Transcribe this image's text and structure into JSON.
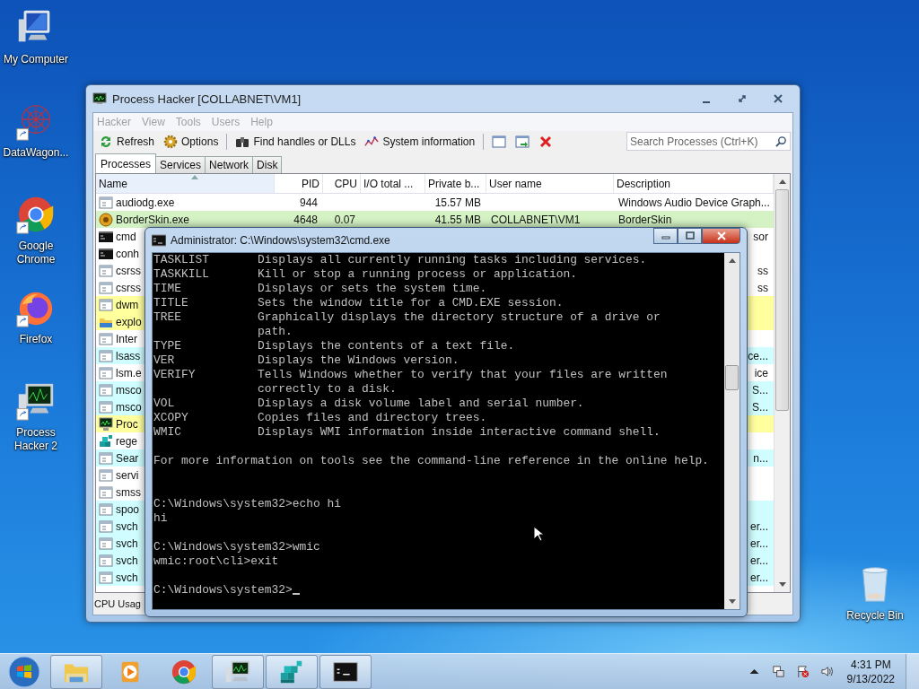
{
  "desktop_icons": [
    {
      "label": "My Computer",
      "kind": "computer",
      "shortcut": false
    },
    {
      "label": "DataWagon...",
      "kind": "datawagon",
      "shortcut": true
    },
    {
      "label": "Google Chrome",
      "kind": "chrome",
      "shortcut": true
    },
    {
      "label": "Firefox",
      "kind": "firefox",
      "shortcut": true
    },
    {
      "label": "Process Hacker 2",
      "kind": "processhacker",
      "shortcut": true
    }
  ],
  "recycle_bin": {
    "label": "Recycle Bin",
    "kind": "recyclebin",
    "shortcut": false
  },
  "process_hacker": {
    "title": "Process Hacker [COLLABNET\\VM1]",
    "menu": [
      "Hacker",
      "View",
      "Tools",
      "Users",
      "Help"
    ],
    "toolbar": [
      {
        "label": "Refresh",
        "kind": "refresh"
      },
      {
        "label": "Options",
        "kind": "gear"
      },
      {
        "label": "Find handles or DLLs",
        "kind": "binoculars"
      },
      {
        "label": "System information",
        "kind": "graph"
      }
    ],
    "toolbar_icons": [
      {
        "kind": "window"
      },
      {
        "kind": "window-arrow"
      },
      {
        "kind": "close"
      }
    ],
    "search": {
      "placeholder": "Search Processes (Ctrl+K)"
    },
    "tabs": [
      {
        "label": "Processes",
        "selected": true
      },
      {
        "label": "Services",
        "selected": false
      },
      {
        "label": "Network",
        "selected": false
      },
      {
        "label": "Disk",
        "selected": false
      }
    ],
    "columns": [
      {
        "label": "Name",
        "sorted": true
      },
      {
        "label": "PID",
        "sorted": false
      },
      {
        "label": "CPU",
        "sorted": false
      },
      {
        "label": "I/O total ...",
        "sorted": false
      },
      {
        "label": "Private b...",
        "sorted": false
      },
      {
        "label": "User name",
        "sorted": false
      },
      {
        "label": "Description",
        "sorted": false
      }
    ],
    "rows": [
      {
        "kind": "window",
        "name": "audiodg.exe",
        "pid": "944",
        "private": "15.57 MB",
        "description": "Windows Audio Device Graph..."
      },
      {
        "kind": "orb",
        "name": "BorderSkin.exe",
        "pid": "4648",
        "cpu": "0.07",
        "private": "41.55 MB",
        "user": "COLLABNET\\VM1",
        "description": "BorderSkin",
        "color": "#d4f2c4"
      },
      {
        "kind": "console",
        "name": "cmd",
        "description": "sor"
      },
      {
        "kind": "console",
        "name": "conh"
      },
      {
        "kind": "window",
        "name": "csrss",
        "description": "ss"
      },
      {
        "kind": "window",
        "name": "csrss",
        "description": "ss"
      },
      {
        "kind": "window",
        "name": "dwm",
        "color": "#ffff9e"
      },
      {
        "kind": "folder",
        "name": "explo",
        "color": "#ffff9e"
      },
      {
        "kind": "window",
        "name": "Inter"
      },
      {
        "kind": "window",
        "name": "lsass",
        "description": "ce...",
        "color": "#d0fdff"
      },
      {
        "kind": "window",
        "name": "lsm.e",
        "description": "ice"
      },
      {
        "kind": "window",
        "name": "msco",
        "description": "S...",
        "color": "#d0fdff"
      },
      {
        "kind": "window",
        "name": "msco",
        "description": "S...",
        "color": "#d0fdff"
      },
      {
        "kind": "monitor",
        "name": "Proc",
        "color": "#ffff9e"
      },
      {
        "kind": "cubes",
        "name": "rege"
      },
      {
        "kind": "window",
        "name": "Sear",
        "description": "n...",
        "color": "#d0fdff"
      },
      {
        "kind": "window",
        "name": "servi"
      },
      {
        "kind": "window",
        "name": "smss"
      },
      {
        "kind": "window",
        "name": "spoo",
        "color": "#d0fdff"
      },
      {
        "kind": "window",
        "name": "svch",
        "description": "er...",
        "color": "#d0fdff"
      },
      {
        "kind": "window",
        "name": "svch",
        "description": "er...",
        "color": "#d0fdff"
      },
      {
        "kind": "window",
        "name": "svch",
        "description": "er...",
        "color": "#d0fdff"
      },
      {
        "kind": "window",
        "name": "svch",
        "description": "er...",
        "color": "#d0fdff"
      }
    ],
    "status_bar": "CPU Usag"
  },
  "cmd": {
    "title": "Administrator: C:\\Windows\\system32\\cmd.exe",
    "cursor_visible": true,
    "lines": [
      {
        "text": "TASKLIST       Displays all currently running tasks including services."
      },
      {
        "text": "TASKKILL       Kill or stop a running process or application."
      },
      {
        "text": "TIME           Displays or sets the system time."
      },
      {
        "text": "TITLE          Sets the window title for a CMD.EXE session."
      },
      {
        "text": "TREE           Graphically displays the directory structure of a drive or"
      },
      {
        "text": "               path."
      },
      {
        "text": "TYPE           Displays the contents of a text file."
      },
      {
        "text": "VER            Displays the Windows version."
      },
      {
        "text": "VERIFY         Tells Windows whether to verify that your files are written"
      },
      {
        "text": "               correctly to a disk."
      },
      {
        "text": "VOL            Displays a disk volume label and serial number."
      },
      {
        "text": "XCOPY          Copies files and directory trees."
      },
      {
        "text": "WMIC           Displays WMI information inside interactive command shell."
      },
      {
        "kind": "blank"
      },
      {
        "text": "For more information on tools see the command-line reference in the online help."
      },
      {
        "kind": "blank"
      },
      {
        "kind": "blank"
      },
      {
        "text": "C:\\Windows\\system32>echo hi"
      },
      {
        "text": "hi"
      },
      {
        "kind": "blank"
      },
      {
        "text": "C:\\Windows\\system32>wmic"
      },
      {
        "text": "wmic:root\\cli>exit"
      },
      {
        "kind": "blank"
      },
      {
        "text": "C:\\Windows\\system32>"
      }
    ]
  },
  "taskbar": {
    "apps": [
      {
        "kind": "explorer",
        "running": true
      },
      {
        "kind": "mediaplayer",
        "running": false
      },
      {
        "kind": "chrome",
        "running": false
      },
      {
        "kind": "processhacker",
        "running": true
      },
      {
        "kind": "regedit",
        "running": true
      },
      {
        "kind": "cmd",
        "running": true
      }
    ],
    "time": "4:31 PM",
    "date": "9/13/2022"
  }
}
